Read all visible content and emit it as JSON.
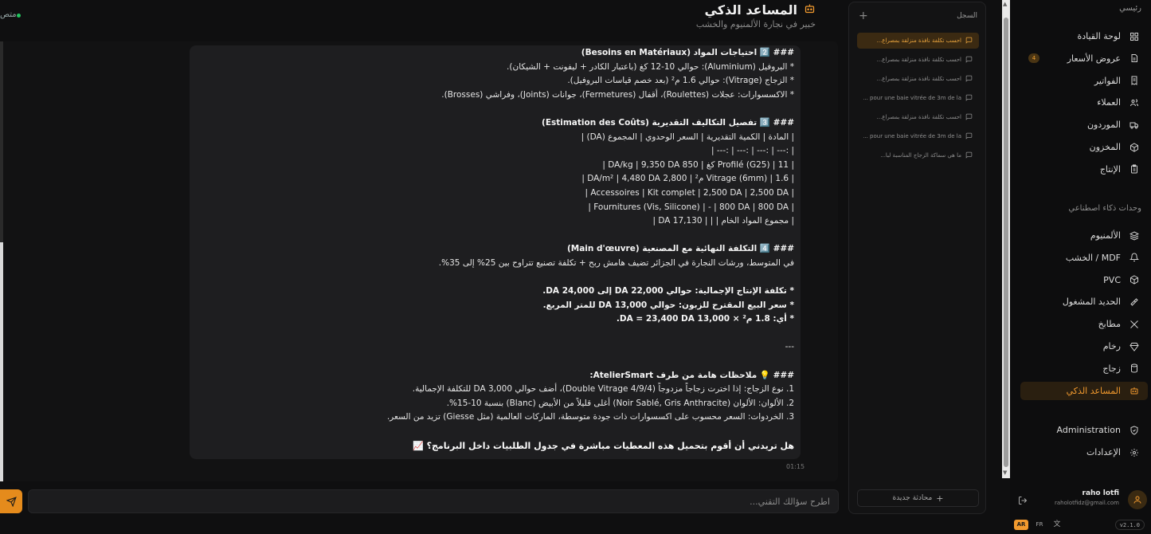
{
  "header": {
    "title": "المساعد الذكي",
    "subtitle": "خبير في نجارة الألمنيوم والخشب",
    "status": "متص"
  },
  "message": {
    "lines": [
      {
        "text": "### 2️⃣ احتياجات المواد (Besoins en Matériaux)",
        "style": "b"
      },
      {
        "text": "* البروفيل (Aluminium): حوالي 10-12 كغ (باعتبار الكادر + ليفونت + الشيكان).",
        "style": ""
      },
      {
        "text": "* الزجاج (Vitrage): حوالي 1.6 م² (بعد خصم قياسات البروفيل).",
        "style": ""
      },
      {
        "text": "* الاكسسوارات: عجلات (Roulettes)، أقفال (Fermetures)، جوانات (Joints)، وفراشي (Brosses).",
        "style": ""
      },
      {
        "text": "",
        "style": ""
      },
      {
        "text": "### 3️⃣ تفصيل التكاليف التقديرية (Estimation des Coûts)",
        "style": "b"
      },
      {
        "text": "| المادة | الكمية التقديرية | السعر الوحدوي | المجموع (DA) |",
        "style": ""
      },
      {
        "text": "| :--- | :--- | :--- | :--- |",
        "style": ""
      },
      {
        "text": "| Profilé (G25) | 11 كغ | 850 DA/kg | 9,350 DA |",
        "style": ""
      },
      {
        "text": "| Vitrage (6mm) | 1.6 م² | 2,800 DA/m² | 4,480 DA |",
        "style": ""
      },
      {
        "text": "| Accessoires | Kit complet | 2,500 DA | 2,500 DA |",
        "style": ""
      },
      {
        "text": "| Fournitures (Vis, Silicone) | - | 800 DA | 800 DA |",
        "style": ""
      },
      {
        "text": "| مجموع المواد الخام | | | 17,130 DA |",
        "style": ""
      },
      {
        "text": "",
        "style": ""
      },
      {
        "text": "### 4️⃣ التكلفة النهائية مع المصنعية (Main d'œuvre)",
        "style": "b"
      },
      {
        "text": "في المتوسط، ورشات النجارة في الجزائر تضيف هامش ربح + تكلفة تصنيع تتراوح بين 25% إلى 35%.",
        "style": ""
      },
      {
        "text": "",
        "style": ""
      },
      {
        "text": "* تكلفة الإنتاج الإجمالية: حوالي 22,000 DA إلى 24,000 DA.",
        "style": "b"
      },
      {
        "text": "* سعر البيع المقترح للزبون: حوالي 13,000 DA للمتر المربع.",
        "style": "b"
      },
      {
        "text": "* أي: 1.8 م² × 13,000 DA = 23,400 DA.",
        "style": "b"
      },
      {
        "text": "",
        "style": ""
      },
      {
        "text": "---",
        "style": ""
      },
      {
        "text": "",
        "style": ""
      },
      {
        "text": "### 💡 ملاحظات هامة من طرف AtelierSmart:",
        "style": "b"
      },
      {
        "text": "1. نوع الزجاج: إذا اخترت زجاجاً مزدوجاً (Double Vitrage 4/9/4)، أضف حوالي 3,000 DA للتكلفة الإجمالية.",
        "style": ""
      },
      {
        "text": "2. الألوان: الألوان (Noir Sablé, Gris Anthracite) أغلى قليلاً من الأبيض (Blanc) بنسبة 10-15%.",
        "style": ""
      },
      {
        "text": "3. الخردوات: السعر محسوب على اكسسوارات ذات جودة متوسطة، الماركات العالمية (مثل Giesse) تزيد من السعر.",
        "style": ""
      },
      {
        "text": "",
        "style": ""
      },
      {
        "text": "هل تريدني أن أقوم بتحميل هذه المعطيات مباشرة في جدول الطلبيات داخل البرنامج؟ 📈",
        "style": "q"
      }
    ],
    "time": "01:15"
  },
  "input": {
    "placeholder": "اطرح سؤالك التقني..."
  },
  "history": {
    "label": "السجل",
    "new_chat": "محادثة جديدة",
    "items": [
      {
        "text": "احسب تكلفة نافذة منزلقة بمصراع...",
        "active": true
      },
      {
        "text": "احسب تكلفة نافذة منزلقة بمصراع...",
        "active": false
      },
      {
        "text": "احسب تكلفة نافذة منزلقة بمصراع...",
        "active": false
      },
      {
        "text": "pour une baie vitrée de 3m de la ...",
        "active": false
      },
      {
        "text": "احسب تكلفة نافذة منزلقة بمصراع...",
        "active": false
      },
      {
        "text": "pour une baie vitrée de 3m de la ...",
        "active": false
      },
      {
        "text": "ما هي سماكة الزجاج المناسبة لبا...",
        "active": false
      }
    ]
  },
  "sidebar": {
    "top": "رئيسي",
    "section_ai": "وحدات ذكاء اصطناعي",
    "items": [
      {
        "label": "لوحة القيادة",
        "icon": "dashboard-icon"
      },
      {
        "label": "عروض الأسعار",
        "icon": "quote-icon",
        "badge": "4"
      },
      {
        "label": "الفواتير",
        "icon": "invoice-icon"
      },
      {
        "label": "العملاء",
        "icon": "users-icon"
      },
      {
        "label": "الموردون",
        "icon": "truck-icon"
      },
      {
        "label": "المخزون",
        "icon": "box-icon"
      },
      {
        "label": "الإنتاج",
        "icon": "clipboard-icon"
      }
    ],
    "ai_items": [
      {
        "label": "الألمنيوم",
        "icon": "layers-icon"
      },
      {
        "label": "الخشب / MDF",
        "icon": "bell-icon"
      },
      {
        "label": "PVC",
        "icon": "cube-icon"
      },
      {
        "label": "الحديد المشغول",
        "icon": "hammer-icon"
      },
      {
        "label": "مطابخ",
        "icon": "utensils-icon"
      },
      {
        "label": "رخام",
        "icon": "gem-icon"
      },
      {
        "label": "زجاج",
        "icon": "cylinder-icon"
      },
      {
        "label": "المساعد الذكي",
        "icon": "bot-icon",
        "active": true
      }
    ],
    "admin": "Administration",
    "settings": "الإعدادات",
    "user": {
      "name": "raho lotfi",
      "email": "raholotfidz@gmail.com"
    },
    "lang_ar": "AR",
    "lang_fr": "FR",
    "version": "v2.1.0"
  },
  "colors": {
    "accent": "#f29a2e",
    "bg": "#0f0f10",
    "panel": "#121213",
    "bubble": "#1e1e20"
  }
}
